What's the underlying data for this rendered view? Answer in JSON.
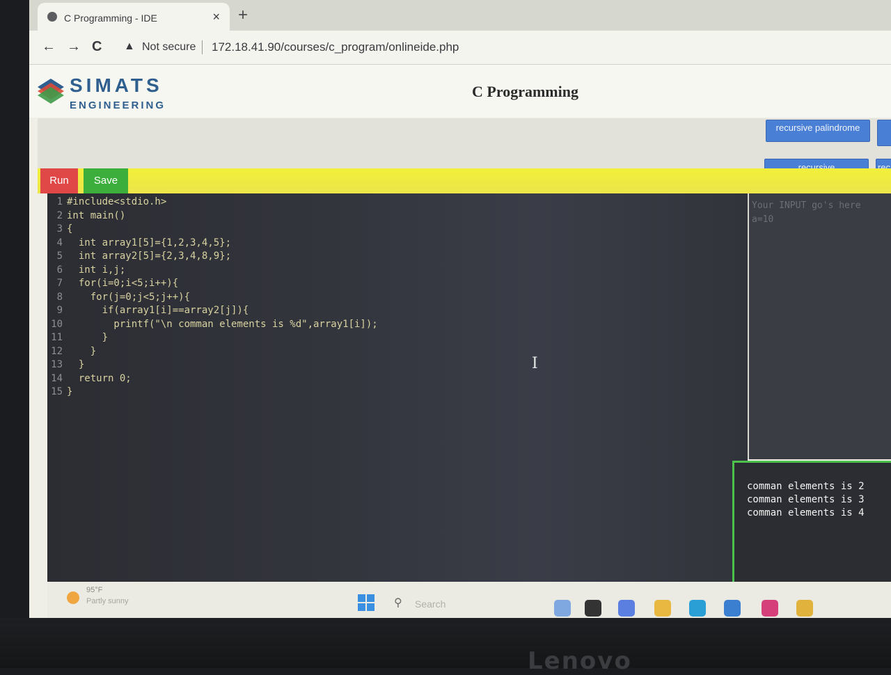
{
  "browser": {
    "tab_title": "C Programming - IDE",
    "tab_close": "×",
    "new_tab": "+",
    "back": "←",
    "forward": "→",
    "reload": "C",
    "security_icon": "warning-triangle-icon",
    "security_glyph": "▲",
    "security_label": "Not secure",
    "url": "172.18.41.90/courses/c_program/onlineide.php"
  },
  "header": {
    "logo_top": "SIMATS",
    "logo_bottom": "ENGINEERING",
    "title": "C Programming"
  },
  "programs": [
    {
      "label": "recursive palindrome"
    },
    {
      "label": "recursive"
    },
    {
      "label": "rec"
    }
  ],
  "toolbar": {
    "run_label": "Run",
    "save_label": "Save"
  },
  "editor": {
    "lines": [
      {
        "num": "1",
        "code": "#include<stdio.h>"
      },
      {
        "num": "2",
        "code": "int main()"
      },
      {
        "num": "3",
        "code": "{"
      },
      {
        "num": "4",
        "code": "  int array1[5]={1,2,3,4,5};"
      },
      {
        "num": "5",
        "code": "  int array2[5]={2,3,4,8,9};"
      },
      {
        "num": "6",
        "code": "  int i,j;"
      },
      {
        "num": "7",
        "code": "  for(i=0;i<5;i++){"
      },
      {
        "num": "8",
        "code": "    for(j=0;j<5;j++){"
      },
      {
        "num": "9",
        "code": "      if(array1[i]==array2[j]){"
      },
      {
        "num": "10",
        "code": "        printf(\"\\n comman elements is %d\",array1[i]);"
      },
      {
        "num": "11",
        "code": "      }"
      },
      {
        "num": "12",
        "code": "    }"
      },
      {
        "num": "13",
        "code": "  }"
      },
      {
        "num": "14",
        "code": "  return 0;"
      },
      {
        "num": "15",
        "code": "}"
      }
    ],
    "cursor": "I"
  },
  "input": {
    "placeholder": "Your INPUT go's here",
    "value": "a=10"
  },
  "output": {
    "lines": [
      "comman elements is 2",
      "comman elements is 3",
      "comman elements is 4"
    ]
  },
  "taskbar": {
    "temperature": "95°F",
    "weather": "Partly sunny",
    "search_placeholder": "Search",
    "search_icon": "search-icon",
    "apps": [
      "bing-icon",
      "file-explorer-taskview-icon",
      "chat-icon",
      "folder-icon",
      "edge-icon",
      "store-icon",
      "instagram-icon",
      "chrome-icon"
    ],
    "app_colors": [
      "#7fa8e0",
      "#333333",
      "#5a7fe0",
      "#e8b840",
      "#2a9fd6",
      "#3b7fd0",
      "#d6407a",
      "#e2b33c"
    ]
  },
  "monitor": {
    "brand": "Lenovo"
  }
}
